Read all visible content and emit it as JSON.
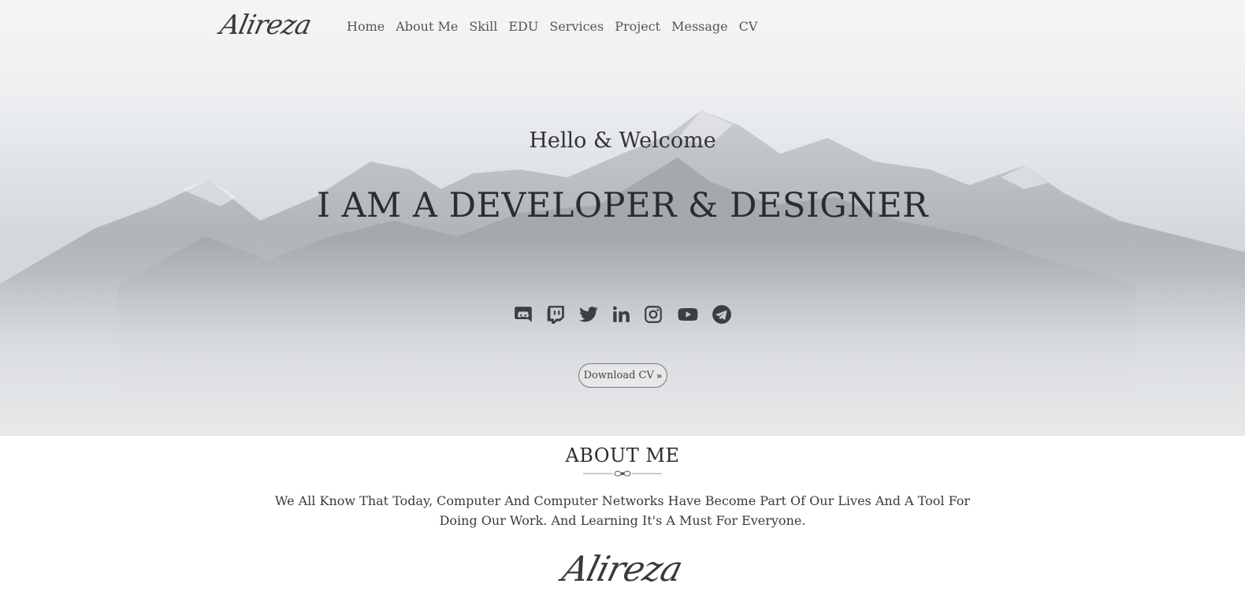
{
  "nav": {
    "logo": "Alireza",
    "items": [
      "Home",
      "About Me",
      "Skill",
      "EDU",
      "Services",
      "Project",
      "Message",
      "CV"
    ]
  },
  "hero": {
    "greeting": "Hello & Welcome",
    "headline": "I AM A DEVELOPER & DESIGNER",
    "socials": [
      "discord-icon",
      "twitch-icon",
      "twitter-icon",
      "linkedin-icon",
      "instagram-icon",
      "youtube-icon",
      "telegram-icon"
    ],
    "download_label": "Download CV"
  },
  "about": {
    "title": "ABOUT ME",
    "text": "We All Know That Today, Computer And Computer Networks Have Become Part Of Our Lives And A Tool For Doing Our Work. And Learning It's A Must For Everyone.",
    "signature": "Alireza"
  },
  "colors": {
    "text_dark": "#2c2c2c",
    "icon": "#3b3f44"
  }
}
